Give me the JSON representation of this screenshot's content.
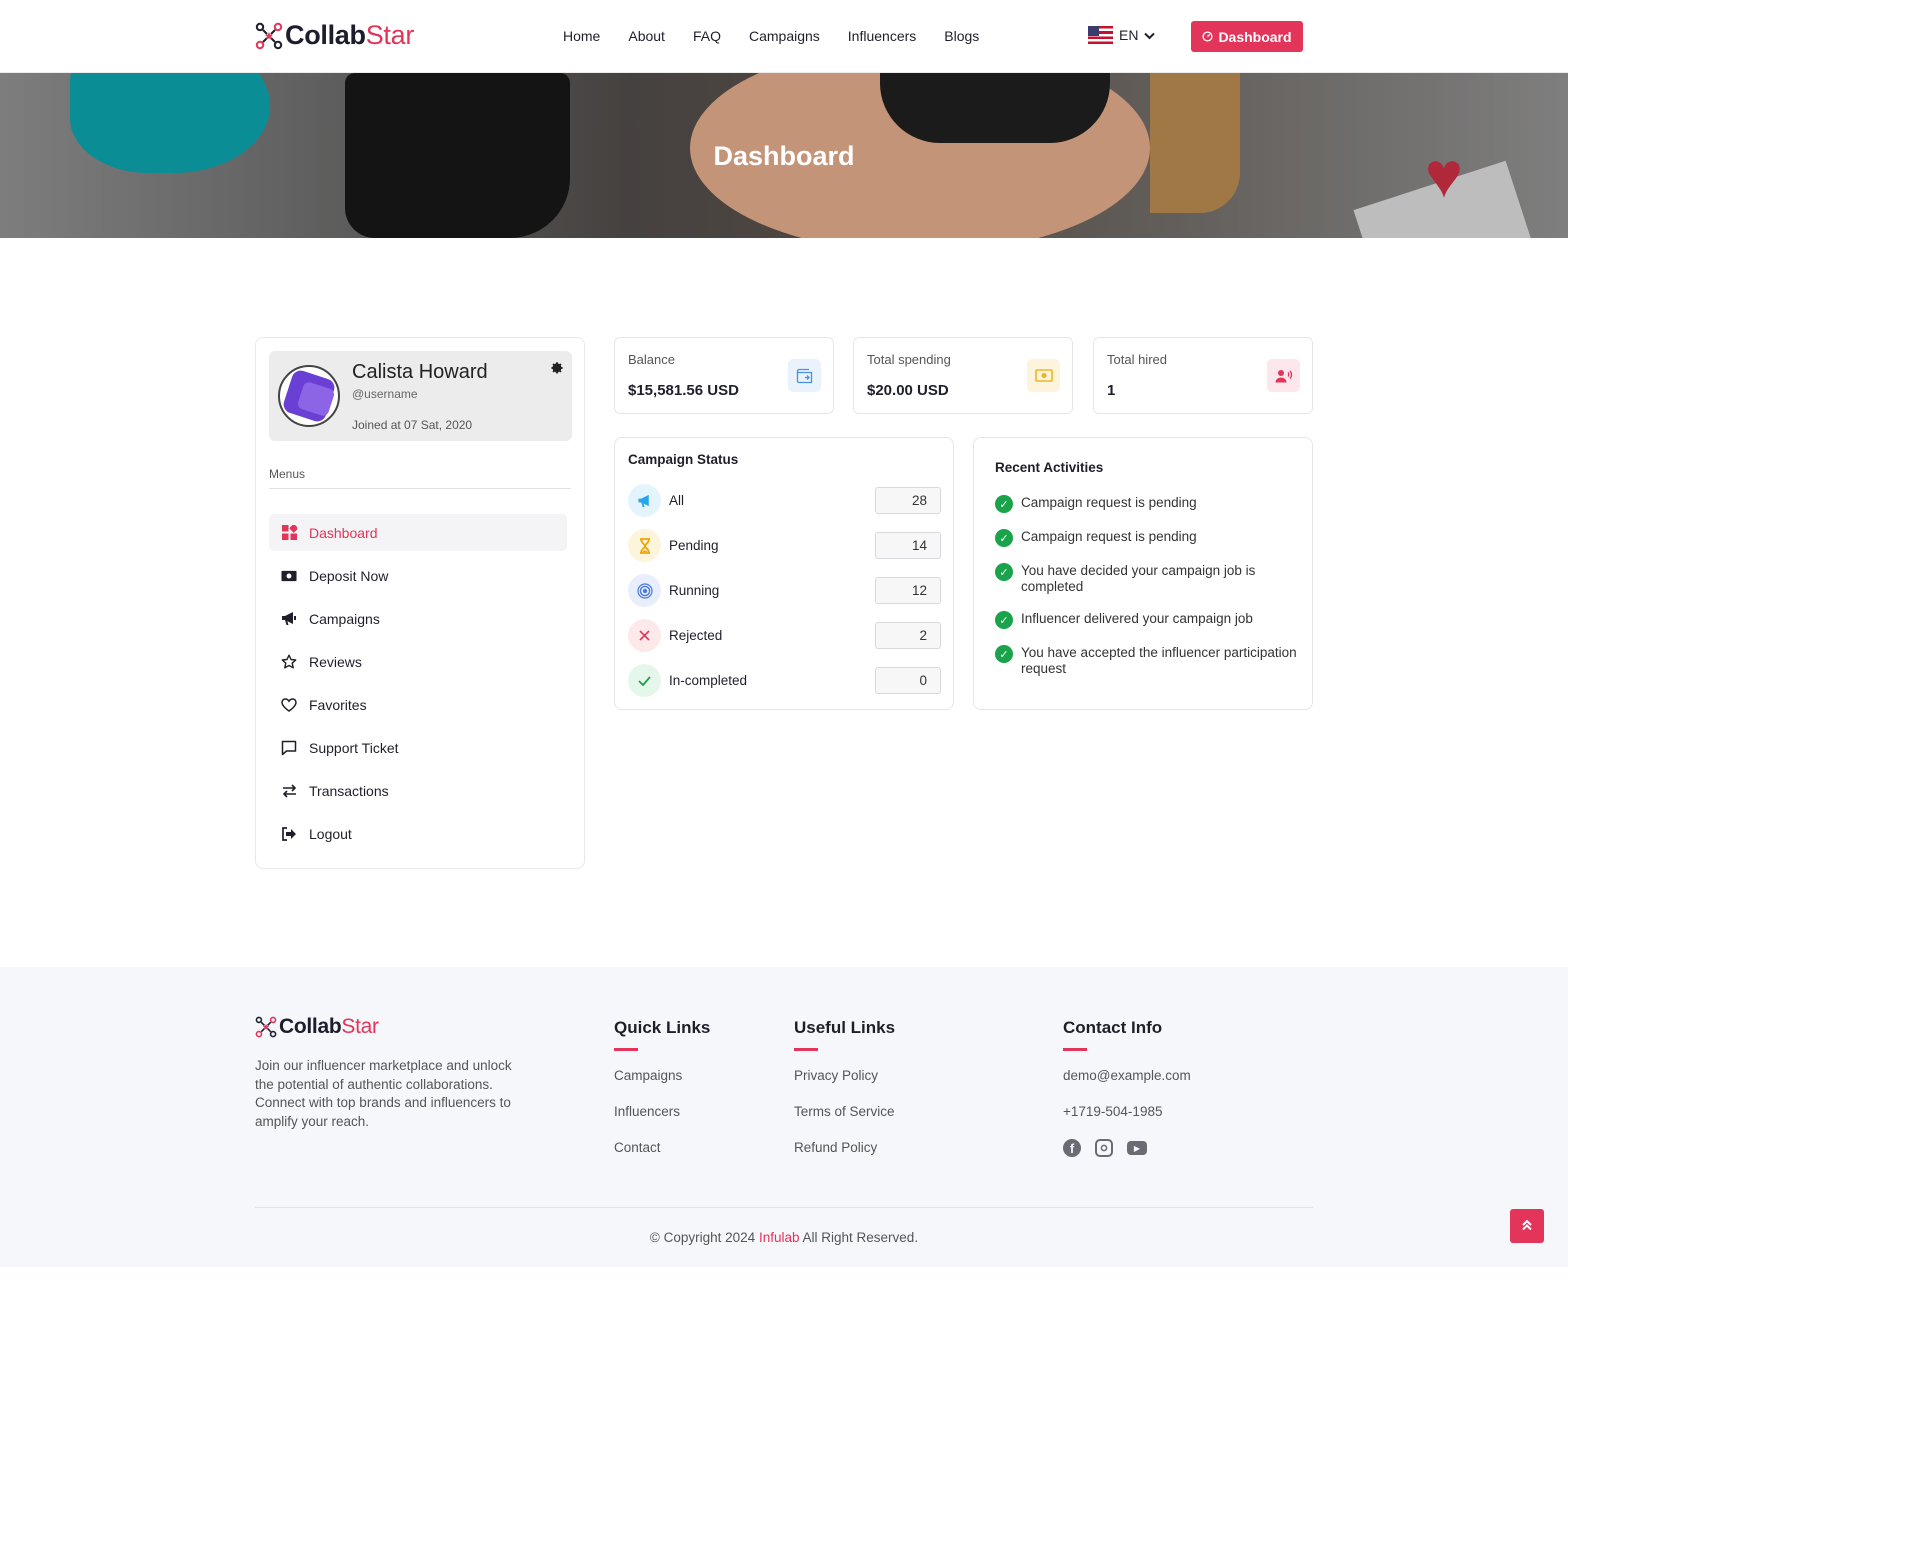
{
  "brand": {
    "name_part1": "Collab",
    "name_part2": "Star",
    "accent_color": "#e33459",
    "logo_icon": "collabstar-logo-icon"
  },
  "nav": {
    "links": [
      "Home",
      "About",
      "FAQ",
      "Campaigns",
      "Influencers",
      "Blogs"
    ],
    "language": "EN",
    "language_flag": "us-flag-icon",
    "dashboard_button": "Dashboard"
  },
  "hero": {
    "title": "Dashboard"
  },
  "profile": {
    "name": "Calista Howard",
    "username": "@username",
    "joined": "Joined at 07 Sat, 2020"
  },
  "sidebar": {
    "menus_label": "Menus",
    "items": [
      {
        "label": "Dashboard",
        "icon": "dashboard-grid-icon",
        "active": true
      },
      {
        "label": "Deposit Now",
        "icon": "money-bill-icon"
      },
      {
        "label": "Campaigns",
        "icon": "megaphone-icon"
      },
      {
        "label": "Reviews",
        "icon": "star-icon"
      },
      {
        "label": "Favorites",
        "icon": "heart-icon"
      },
      {
        "label": "Support Ticket",
        "icon": "chat-bubble-icon"
      },
      {
        "label": "Transactions",
        "icon": "exchange-arrows-icon"
      },
      {
        "label": "Logout",
        "icon": "logout-icon"
      }
    ]
  },
  "stats": [
    {
      "label": "Balance",
      "value": "$15,581.56 USD",
      "icon": "wallet-icon",
      "icon_color": "#4a90e2"
    },
    {
      "label": "Total spending",
      "value": "$20.00 USD",
      "icon": "cash-icon",
      "icon_color": "#f0b429"
    },
    {
      "label": "Total hired",
      "value": "1",
      "icon": "user-voice-icon",
      "icon_color": "#e33459"
    }
  ],
  "campaign_status": {
    "title": "Campaign Status",
    "rows": [
      {
        "label": "All",
        "count": "28",
        "icon": "megaphone-icon"
      },
      {
        "label": "Pending",
        "count": "14",
        "icon": "hourglass-icon"
      },
      {
        "label": "Running",
        "count": "12",
        "icon": "broadcast-icon"
      },
      {
        "label": "Rejected",
        "count": "2",
        "icon": "close-icon"
      },
      {
        "label": "In-completed",
        "count": "0",
        "icon": "check-icon"
      }
    ]
  },
  "recent_activities": {
    "title": "Recent Activities",
    "items": [
      "Campaign request is pending",
      "Campaign request is pending",
      "You have decided your campaign job is completed",
      "Influencer delivered your campaign job",
      "You have accepted the influencer participation request"
    ]
  },
  "footer": {
    "about": "Join our influencer marketplace and unlock the potential of authentic collaborations. Connect with top brands and influencers to amplify your reach.",
    "quick_links": {
      "title": "Quick Links",
      "links": [
        "Campaigns",
        "Influencers",
        "Contact"
      ]
    },
    "useful_links": {
      "title": "Useful Links",
      "links": [
        "Privacy Policy",
        "Terms of Service",
        "Refund Policy"
      ]
    },
    "contact": {
      "title": "Contact Info",
      "email": "demo@example.com",
      "phone": "+1719-504-1985",
      "social": [
        "facebook-icon",
        "instagram-icon",
        "youtube-icon"
      ]
    },
    "copyright_prefix": "© Copyright 2024",
    "copyright_brand": "Infulab",
    "copyright_suffix": "All Right Reserved."
  }
}
